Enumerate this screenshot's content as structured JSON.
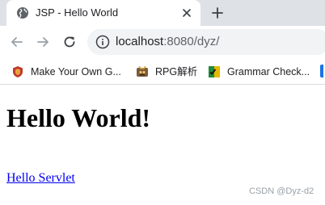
{
  "browser": {
    "tab": {
      "title": "JSP - Hello World",
      "icon": "globe-icon"
    },
    "address": {
      "host": "localhost",
      "path": ":8080/dyz/"
    },
    "bookmarks": [
      {
        "label": "Make Your Own G...",
        "icon": "shield-icon"
      },
      {
        "label": "RPG解析",
        "icon": "rpg-icon"
      },
      {
        "label": "Grammar Check...",
        "icon": "grammar-icon"
      }
    ]
  },
  "page": {
    "heading": "Hello World!",
    "link": "Hello Servlet",
    "watermark": "CSDN @Dyz-d2"
  },
  "colors": {
    "tabstrip": "#dee1e6",
    "omnibox": "#f1f3f4",
    "link": "#0000ee",
    "accent": "#1a73e8"
  }
}
